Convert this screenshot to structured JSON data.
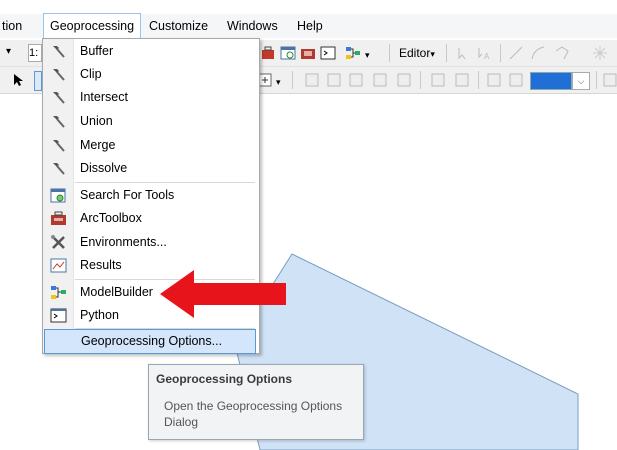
{
  "menubar": {
    "items": [
      "tion",
      "Geoprocessing",
      "Customize",
      "Windows",
      "Help"
    ]
  },
  "toolbar": {
    "scale_fragment": "1:",
    "editor_label": "Editor",
    "editor_arrow": "▾",
    "dropdown_arrow": "⌵"
  },
  "menu": {
    "items": [
      {
        "label": "Buffer",
        "icon": "hammer-icon"
      },
      {
        "label": "Clip",
        "icon": "hammer-icon"
      },
      {
        "label": "Intersect",
        "icon": "hammer-icon"
      },
      {
        "label": "Union",
        "icon": "hammer-icon"
      },
      {
        "label": "Merge",
        "icon": "hammer-icon"
      },
      {
        "label": "Dissolve",
        "icon": "hammer-icon"
      },
      {
        "label": "Search For Tools",
        "icon": "search-window-icon"
      },
      {
        "label": "ArcToolbox",
        "icon": "toolbox-icon"
      },
      {
        "label": "Environments...",
        "icon": "tools-wrench-icon"
      },
      {
        "label": "Results",
        "icon": "results-icon"
      },
      {
        "label": "ModelBuilder",
        "icon": "modelbuilder-icon"
      },
      {
        "label": "Python",
        "icon": "python-window-icon"
      },
      {
        "label": "Geoprocessing Options...",
        "icon": ""
      }
    ]
  },
  "tooltip": {
    "title": "Geoprocessing Options",
    "body": "Open the Geoprocessing Options Dialog"
  },
  "colors": {
    "arrow": "#e8141b",
    "polygon_fill": "#cfe2f6",
    "polygon_stroke": "#7a9cc0",
    "highlight": "#d4e6fb",
    "highlight_border": "#5b9bd5"
  }
}
